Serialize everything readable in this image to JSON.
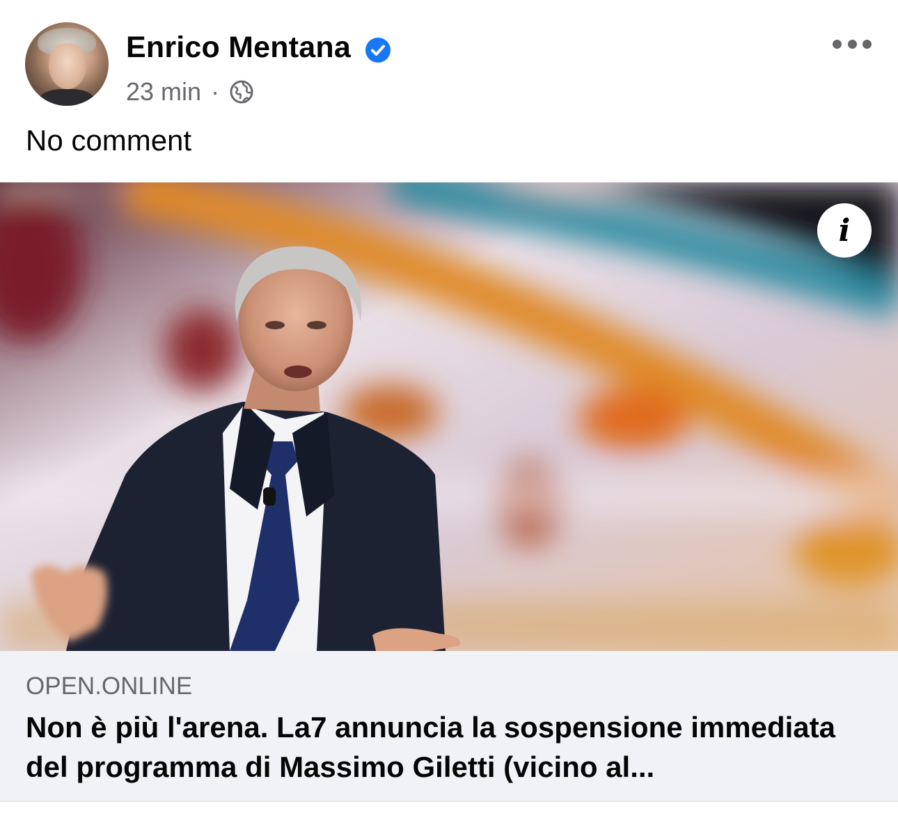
{
  "post": {
    "author_name": "Enrico Mentana",
    "verified_icon": "verified-badge-icon",
    "timestamp": "23 min",
    "separator": "·",
    "audience_icon": "globe-icon",
    "more_icon": "more-options-icon",
    "text": "No comment"
  },
  "link_preview": {
    "info_label": "i",
    "domain": "OPEN.ONLINE",
    "title": "Non è più l'arena. La7 annuncia la sospensione immediata del programma di Massimo Giletti (vicino al..."
  },
  "colors": {
    "name": "#050505",
    "meta": "#65676b",
    "verified": "#1877f2",
    "footer_bg": "#f0f2f5"
  }
}
